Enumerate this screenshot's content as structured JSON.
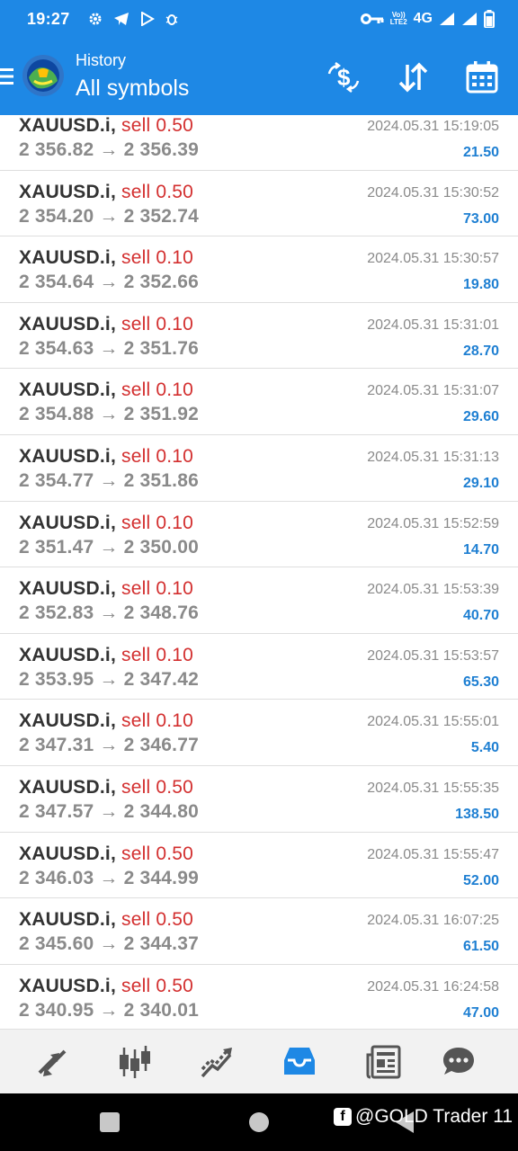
{
  "status_bar": {
    "time": "19:27",
    "network": "4G",
    "volte_line1": "Vo))",
    "volte_line2": "LTE2"
  },
  "app_bar": {
    "subtitle": "History",
    "title": "All symbols",
    "accent_color": "#1e88e5"
  },
  "trades": [
    {
      "symbol": "XAUUSD.i,",
      "side": "sell 0.50",
      "prices": "2 356.82 → 2 356.39",
      "time": "2024.05.31 15:19:05",
      "profit": "21.50"
    },
    {
      "symbol": "XAUUSD.i,",
      "side": "sell 0.50",
      "prices": "2 354.20 → 2 352.74",
      "time": "2024.05.31 15:30:52",
      "profit": "73.00"
    },
    {
      "symbol": "XAUUSD.i,",
      "side": "sell 0.10",
      "prices": "2 354.64 → 2 352.66",
      "time": "2024.05.31 15:30:57",
      "profit": "19.80"
    },
    {
      "symbol": "XAUUSD.i,",
      "side": "sell 0.10",
      "prices": "2 354.63 → 2 351.76",
      "time": "2024.05.31 15:31:01",
      "profit": "28.70"
    },
    {
      "symbol": "XAUUSD.i,",
      "side": "sell 0.10",
      "prices": "2 354.88 → 2 351.92",
      "time": "2024.05.31 15:31:07",
      "profit": "29.60"
    },
    {
      "symbol": "XAUUSD.i,",
      "side": "sell 0.10",
      "prices": "2 354.77 → 2 351.86",
      "time": "2024.05.31 15:31:13",
      "profit": "29.10"
    },
    {
      "symbol": "XAUUSD.i,",
      "side": "sell 0.10",
      "prices": "2 351.47 → 2 350.00",
      "time": "2024.05.31 15:52:59",
      "profit": "14.70"
    },
    {
      "symbol": "XAUUSD.i,",
      "side": "sell 0.10",
      "prices": "2 352.83 → 2 348.76",
      "time": "2024.05.31 15:53:39",
      "profit": "40.70"
    },
    {
      "symbol": "XAUUSD.i,",
      "side": "sell 0.10",
      "prices": "2 353.95 → 2 347.42",
      "time": "2024.05.31 15:53:57",
      "profit": "65.30"
    },
    {
      "symbol": "XAUUSD.i,",
      "side": "sell 0.10",
      "prices": "2 347.31 → 2 346.77",
      "time": "2024.05.31 15:55:01",
      "profit": "5.40"
    },
    {
      "symbol": "XAUUSD.i,",
      "side": "sell 0.50",
      "prices": "2 347.57 → 2 344.80",
      "time": "2024.05.31 15:55:35",
      "profit": "138.50"
    },
    {
      "symbol": "XAUUSD.i,",
      "side": "sell 0.50",
      "prices": "2 346.03 → 2 344.99",
      "time": "2024.05.31 15:55:47",
      "profit": "52.00"
    },
    {
      "symbol": "XAUUSD.i,",
      "side": "sell 0.50",
      "prices": "2 345.60 → 2 344.37",
      "time": "2024.05.31 16:07:25",
      "profit": "61.50"
    },
    {
      "symbol": "XAUUSD.i,",
      "side": "sell 0.50",
      "prices": "2 340.95 → 2 340.01",
      "time": "2024.05.31 16:24:58",
      "profit": "47.00"
    }
  ],
  "bottom_nav": {
    "items": [
      "quotes-icon",
      "chart-icon",
      "trade-icon",
      "history-icon",
      "news-icon",
      "chat-icon"
    ],
    "active": "history-icon",
    "active_color": "#1e88e5"
  },
  "watermark": {
    "fb_letter": "f",
    "text": "@GOLD Trader 11"
  }
}
